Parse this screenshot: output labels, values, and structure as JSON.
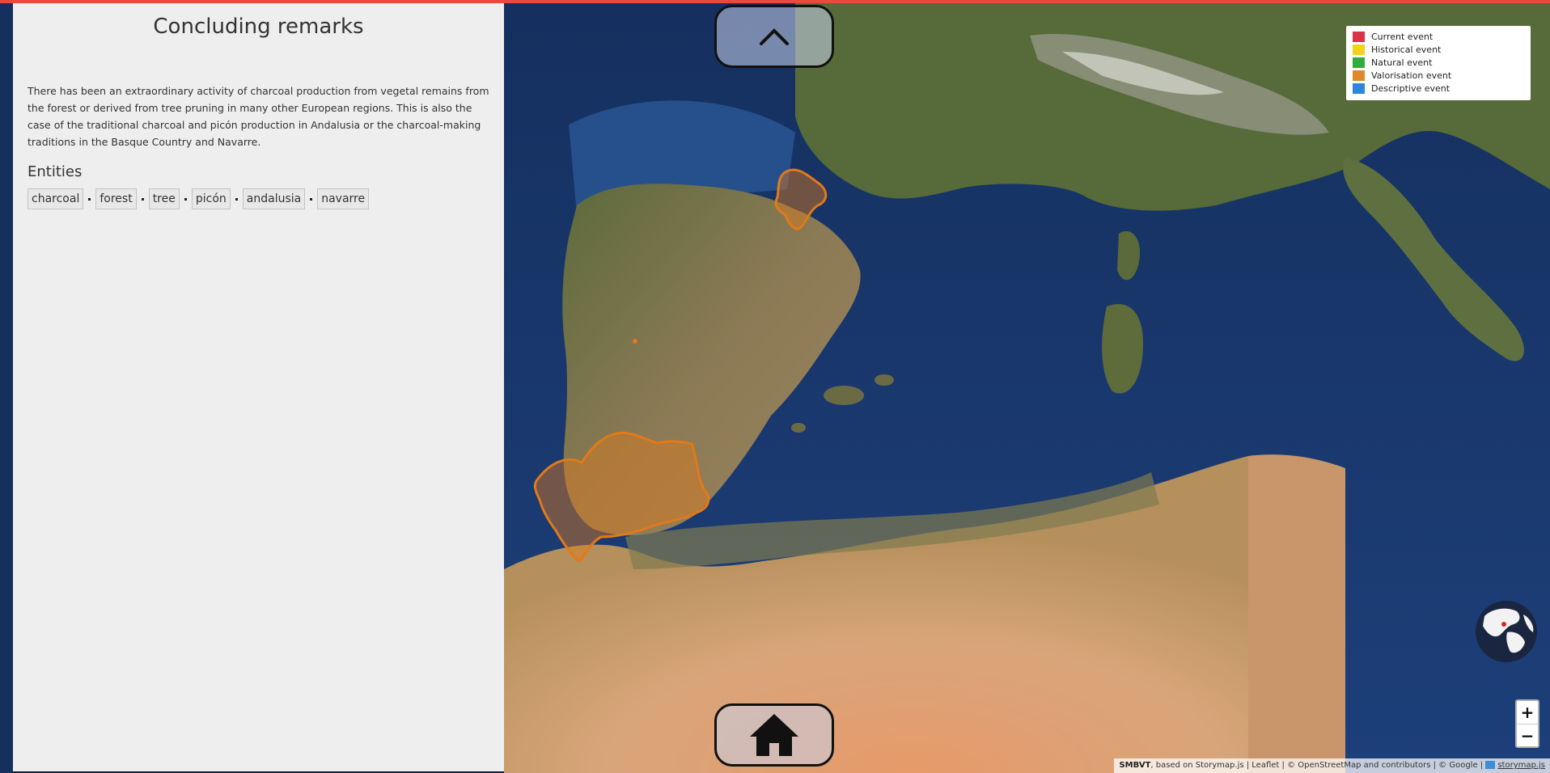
{
  "panel": {
    "title": "Concluding remarks",
    "description": "There has been an extraordinary activity of charcoal production from vegetal remains from the forest or derived from tree pruning in many other European regions. This is also the case of the traditional charcoal and picón production in Andalusia or the charcoal-making traditions in the Basque Country and Navarre.",
    "entities_heading": "Entities",
    "entities": [
      "charcoal",
      "forest",
      "tree",
      "picón",
      "andalusia",
      "navarre"
    ]
  },
  "navigation": {
    "up_icon": "chevron-up-icon",
    "home_icon": "home-icon"
  },
  "legend": {
    "items": [
      {
        "label": "Current event",
        "color": "#d9334a"
      },
      {
        "label": "Historical event",
        "color": "#f2d21b"
      },
      {
        "label": "Natural event",
        "color": "#2fae3b"
      },
      {
        "label": "Valorisation event",
        "color": "#e0892a"
      },
      {
        "label": "Descriptive event",
        "color": "#2f86d6"
      }
    ]
  },
  "map": {
    "highlight_color": "#e07a1a",
    "highlighted_regions": [
      "Navarre",
      "Andalusia"
    ]
  },
  "zoom": {
    "in_label": "+",
    "out_label": "−"
  },
  "attribution": {
    "brand": "SMBVT",
    "text": ", based on Storymap.js | Leaflet | © OpenStreetMap and contributors | © Google | ",
    "link": "storymap.js"
  }
}
